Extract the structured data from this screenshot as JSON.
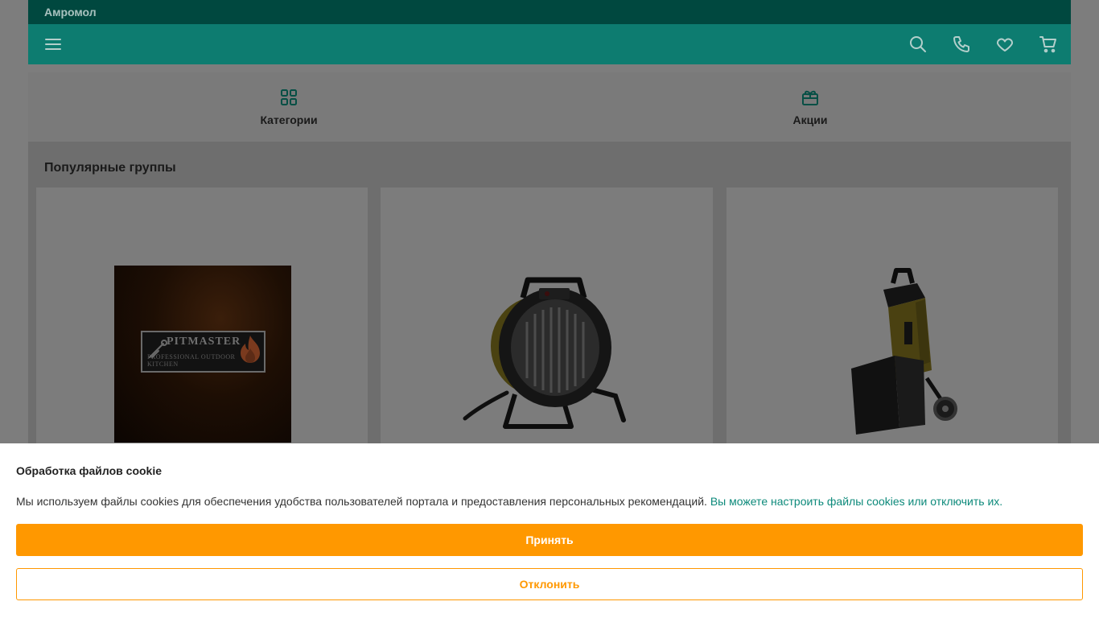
{
  "header": {
    "brand": "Амромол",
    "icons": [
      "menu-icon",
      "search-icon",
      "phone-icon",
      "heart-icon",
      "cart-icon"
    ]
  },
  "quick_links": [
    {
      "label": "Категории",
      "icon": "grid-icon"
    },
    {
      "label": "Акции",
      "icon": "gift-icon"
    }
  ],
  "popular_groups": {
    "title": "Популярные группы",
    "cards": [
      {
        "image": "pitmaster-logo",
        "logo_name": "PITMASTER",
        "logo_sub": "PROFESSIONAL OUTDOOR KITCHEN"
      },
      {
        "image": "fan-heater"
      },
      {
        "image": "garden-shredder"
      }
    ]
  },
  "cookie": {
    "title": "Обработка файлов cookie",
    "text": "Мы используем файлы cookies для обеспечения удобства пользователей портала и предоставления персональных рекомендаций.",
    "link": "Вы можете настроить файлы cookies или отключить их.",
    "accept": "Принять",
    "decline": "Отклонить"
  },
  "colors": {
    "brand_dark": "#00483f",
    "brand": "#0d7c70",
    "accent": "#ff9800",
    "link": "#0d8a7b"
  }
}
